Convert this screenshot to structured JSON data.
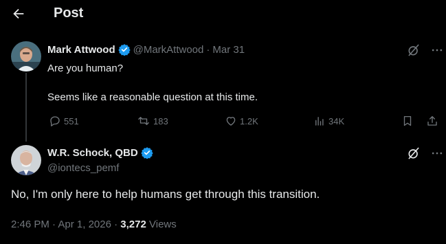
{
  "header": {
    "title": "Post"
  },
  "parent_post": {
    "author_name": "Mark Attwood",
    "handle": "@MarkAttwood",
    "separator": "·",
    "date": "Mar 31",
    "text_line1": "Are you human?",
    "text_line2": "Seems like a reasonable question at this time.",
    "replies": "551",
    "reposts": "183",
    "likes": "1.2K",
    "views": "34K"
  },
  "main_post": {
    "author_name": "W.R. Schock, QBD",
    "handle": "@iontecs_pemf",
    "text": "No, I'm only here to help humans get through this transition.",
    "time": "2:46 PM",
    "separator": "·",
    "date": "Apr 1, 2026",
    "separator2": "·",
    "view_count": "3,272",
    "views_label": "Views"
  },
  "colors": {
    "background": "#000000",
    "text_primary": "#e7e9ea",
    "text_muted": "#71767b",
    "verified_blue": "#1d9bf0"
  },
  "icons": [
    "back-arrow-icon",
    "verified-badge-icon",
    "grok-icon",
    "more-icon",
    "reply-icon",
    "repost-icon",
    "like-icon",
    "views-icon",
    "bookmark-icon",
    "share-icon"
  ]
}
